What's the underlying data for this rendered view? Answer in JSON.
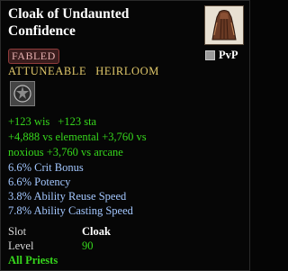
{
  "tooltip": {
    "title": "Cloak of Undaunted Confidence",
    "item_icon": "cloak-icon",
    "pvp": {
      "label": "PvP",
      "checked": false
    },
    "tier_badge": "FABLED",
    "tags": [
      "ATTUNEABLE",
      "HEIRLOOM"
    ],
    "adornment_slot_icon": "adornment-slot-icon",
    "stats": {
      "line1": [
        "+123 wis",
        "+123 sta"
      ],
      "line2": "+4,888 vs elemental  +3,760 vs",
      "line3": "noxious  +3,760 vs arcane"
    },
    "bonuses": [
      "6.6% Crit Bonus",
      "6.6% Potency",
      "3.8% Ability Reuse Speed",
      "7.8% Ability Casting Speed"
    ],
    "slot": {
      "label": "Slot",
      "value": "Cloak"
    },
    "level": {
      "label": "Level",
      "value": "90"
    },
    "classes": "All Priests"
  },
  "colors": {
    "stat_green": "#36d61c",
    "bonus_blue": "#a3c7ff",
    "tag_gold": "#e1c86a",
    "badge_red": "#8f3a3a"
  }
}
